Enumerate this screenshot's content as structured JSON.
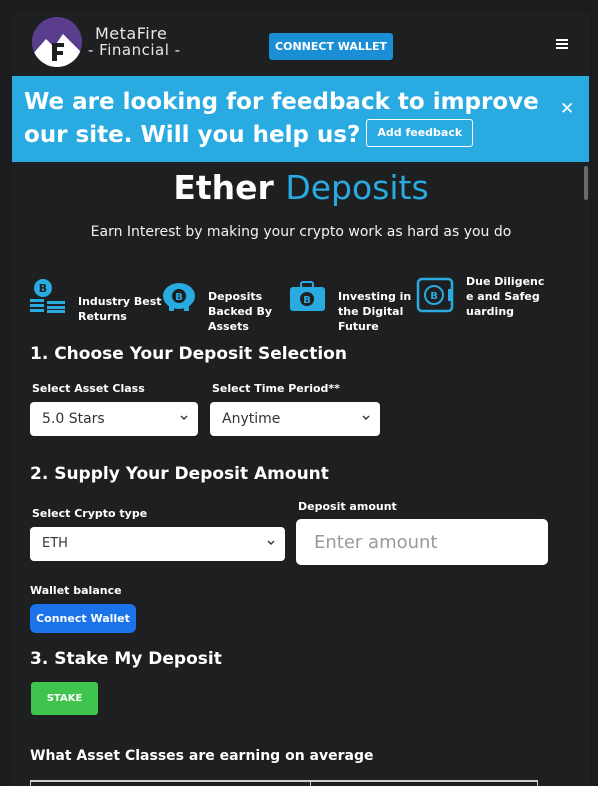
{
  "header": {
    "logo_line1": "MetaFire",
    "logo_line2": "- Financial -",
    "connect_label": "CONNECT WALLET",
    "menu_icon": "hamburger-menu-icon"
  },
  "banner": {
    "text": "We are looking for feedback to improve our site. Will you help us?",
    "feedback_label": "Add feedback",
    "close_label": "✕",
    "color": "#29abe2"
  },
  "hero": {
    "title_word1": "Ether",
    "title_word2": "Deposits",
    "subtitle": "Earn Interest by making your crypto work as hard as you do"
  },
  "features": [
    {
      "icon": "bitcoin-stacks-icon",
      "label": "Industry Best Returns"
    },
    {
      "icon": "bitcoin-piggy-bank-icon",
      "label": "Deposits Backed By Assets"
    },
    {
      "icon": "bitcoin-briefcase-icon",
      "label": "Investing in the Digital Future"
    },
    {
      "icon": "bitcoin-vault-icon",
      "label": "Due Diligence and Safeguarding"
    }
  ],
  "step1": {
    "heading": "1. Choose Your Deposit Selection",
    "asset_label": "Select Asset Class",
    "asset_value": "5.0 Stars",
    "period_label": "Select Time Period**",
    "period_value": "Anytime"
  },
  "step2": {
    "heading": "2. Supply Your Deposit Amount",
    "crypto_label": "Select Crypto type",
    "crypto_value": "ETH",
    "amount_label": "Deposit amount",
    "amount_placeholder": "Enter amount",
    "wallet_label": "Wallet balance",
    "wallet_button": "Connect Wallet"
  },
  "step3": {
    "heading": "3. Stake My Deposit",
    "stake_button": "STAKE"
  },
  "earning": {
    "heading": "What Asset Classes are earning on average"
  },
  "colors": {
    "accent": "#29abe2",
    "wallet_button": "#1a73e8",
    "stake_button": "#3fc54d",
    "background": "#1e1f21"
  }
}
